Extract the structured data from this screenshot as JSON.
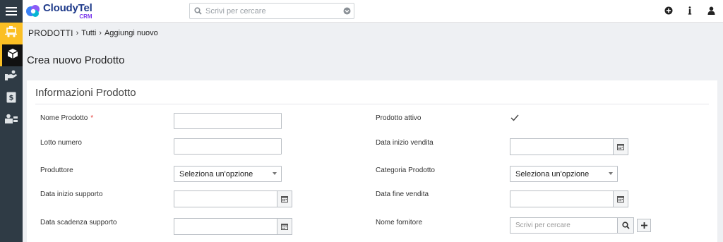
{
  "app": {
    "logo_name": "CloudyTel",
    "logo_sub": "CRM"
  },
  "search": {
    "placeholder": "Scrivi per cercare"
  },
  "header_icons": [
    "plus-circle-icon",
    "info-icon",
    "user-icon"
  ],
  "rail_items": [
    {
      "name": "rail-item-sales",
      "icon": "cart-icon"
    },
    {
      "name": "rail-item-products",
      "icon": "box-icon",
      "active": true
    },
    {
      "name": "rail-item-support",
      "icon": "hand-icon"
    },
    {
      "name": "rail-item-billing",
      "icon": "invoice-icon"
    },
    {
      "name": "rail-item-contacts",
      "icon": "contact-icon"
    }
  ],
  "breadcrumb": {
    "root": "PRODOTTI",
    "level1": "Tutti",
    "level2": "Aggiungi nuovo"
  },
  "page": {
    "title": "Crea nuovo Prodotto"
  },
  "panel": {
    "title": "Informazioni Prodotto"
  },
  "form": {
    "product_name": {
      "label": "Nome Prodotto",
      "required": "*",
      "value": ""
    },
    "product_active": {
      "label": "Prodotto attivo",
      "checked": true
    },
    "lot_number": {
      "label": "Lotto numero",
      "value": ""
    },
    "sales_start_date": {
      "label": "Data inizio vendita",
      "value": ""
    },
    "manufacturer": {
      "label": "Produttore",
      "value": "Seleziona un'opzione"
    },
    "product_category": {
      "label": "Categoria Prodotto",
      "value": "Seleziona un'opzione"
    },
    "support_start_date": {
      "label": "Data inizio supporto",
      "value": ""
    },
    "sales_end_date": {
      "label": "Data fine vendita",
      "value": ""
    },
    "support_expiry_date": {
      "label": "Data scadenza supporto",
      "value": ""
    },
    "vendor_name": {
      "label": "Nome fornitore",
      "placeholder": "Scrivi per cercare"
    }
  }
}
